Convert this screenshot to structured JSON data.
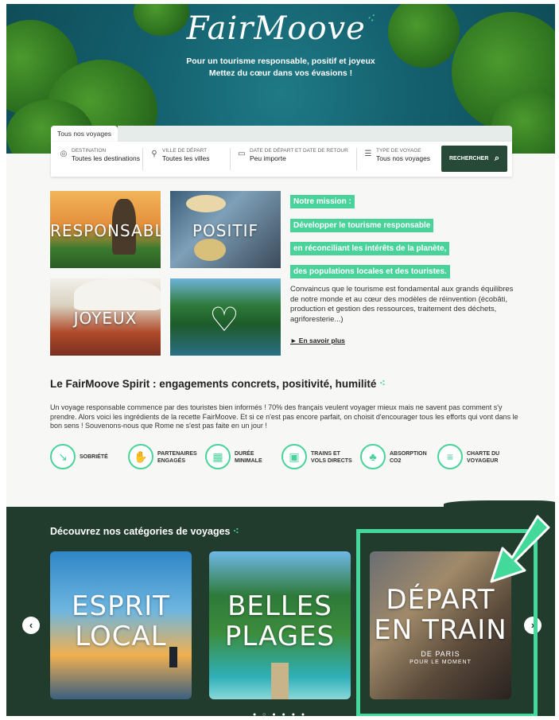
{
  "brand": {
    "logo_text": "FairMoove",
    "tagline_1": "Pour un tourisme responsable, positif et joyeux",
    "tagline_2": "Mettez du cœur dans vos évasions !"
  },
  "search": {
    "tab_label": "Tous nos voyages",
    "fields": [
      {
        "label": "DESTINATION",
        "value": "Toutes les destinations",
        "icon": "globe-icon"
      },
      {
        "label": "VILLE DE DÉPART",
        "value": "Toutes les villes",
        "icon": "map-pin-icon"
      },
      {
        "label": "DATE DE DÉPART ET DATE DE RETOUR",
        "value": "Peu importe",
        "icon": "calendar-icon"
      },
      {
        "label": "TYPE DE VOYAGE",
        "value": "Tous nos voyages",
        "icon": "list-icon"
      }
    ],
    "button_label": "RECHERCHER"
  },
  "tiles": [
    {
      "label": "RESPONSABLE"
    },
    {
      "label": "POSITIF"
    },
    {
      "label": "JOYEUX"
    },
    {
      "label": ""
    }
  ],
  "mission": {
    "highlights": [
      "Notre mission :",
      "Développer le tourisme responsable",
      "en réconciliant les intérêts de la planète,",
      "des populations locales et des touristes."
    ],
    "text": "Convaincus que le tourisme est fondamental aux grands équilibres de notre monde et au cœur des modèles de réinvention (écobâti, production et gestion des ressources, traitement des déchets, agriforesterie...)",
    "link": "► En savoir plus"
  },
  "spirit": {
    "title": "Le FairMoove Spirit : engagements concrets, positivité, humilité",
    "text": "Un voyage responsable commence par des touristes bien informés ! 70% des français veulent voyager mieux mais ne savent pas comment s'y prendre. Alors voici les ingrédients de la recette FairMoove. Et si ce n'est pas encore parfait, on choisit d'encourager tous les efforts qui vont dans le bon sens ! Souvenons-nous que Rome ne s'est pas faite en un jour !",
    "features": [
      {
        "line1": "SOBRIÉTÉ",
        "line2": ""
      },
      {
        "line1": "PARTENAIRES",
        "line2": "ENGAGÉS"
      },
      {
        "line1": "DURÉE",
        "line2": "MINIMALE"
      },
      {
        "line1": "TRAINS ET",
        "line2": "VOLS DIRECTS"
      },
      {
        "line1": "ABSORPTION",
        "line2": "CO2"
      },
      {
        "line1": "CHARTE DU",
        "line2": "VOYAGEUR"
      }
    ]
  },
  "categories": {
    "title": "Découvrez nos catégories de voyages",
    "cards": [
      {
        "line1": "ESPRIT",
        "line2": "LOCAL",
        "sub1": "",
        "sub2": ""
      },
      {
        "line1": "BELLES",
        "line2": "PLAGES",
        "sub1": "",
        "sub2": ""
      },
      {
        "line1": "DÉPART",
        "line2": "EN TRAIN",
        "sub1": "DE PARIS",
        "sub2": "POUR LE MOMENT"
      }
    ],
    "prev": "‹",
    "next": "›",
    "dots": "● ○ ● ● ● ●"
  },
  "colors": {
    "accent": "#49d39a",
    "dark": "#213c2d",
    "annotation": "#43d99a"
  }
}
